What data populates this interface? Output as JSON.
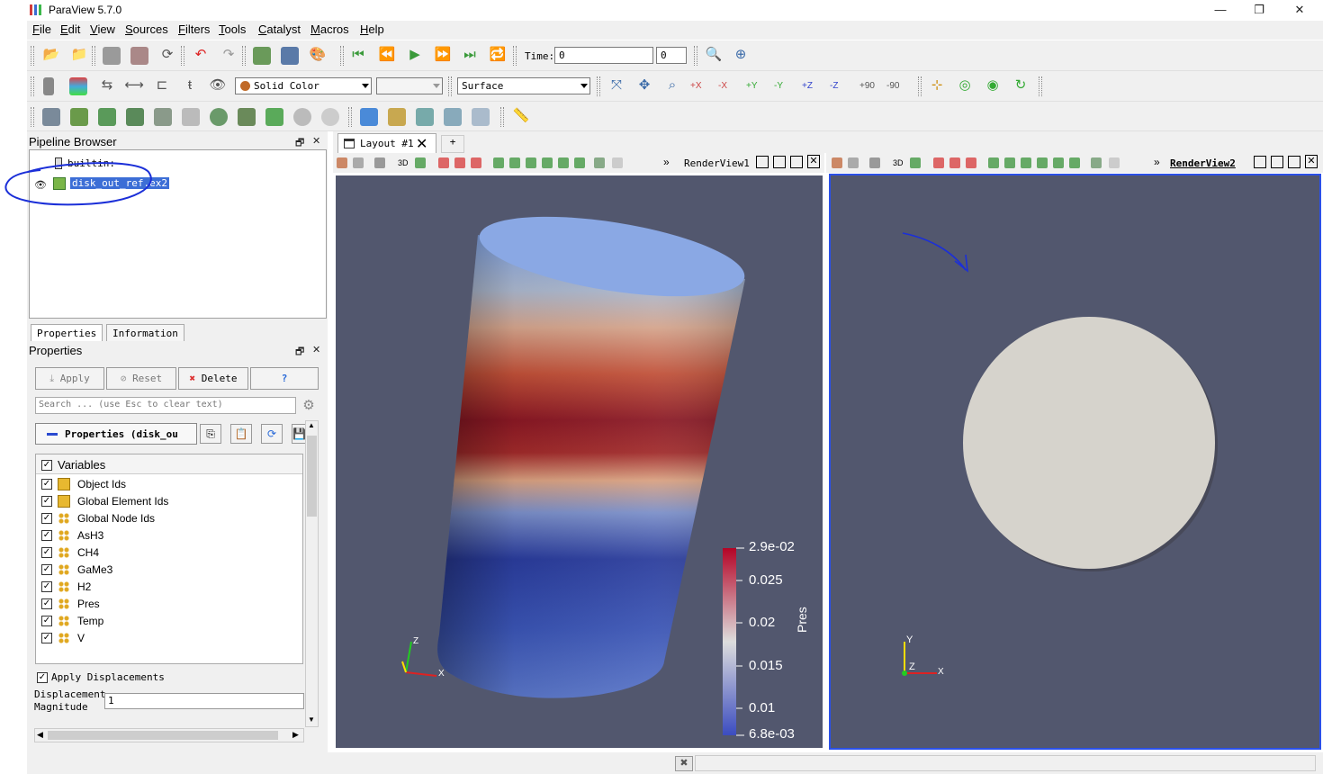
{
  "window": {
    "title": "ParaView 5.7.0",
    "minimize": "—",
    "maximize": "❐",
    "close": "✕"
  },
  "menu": [
    "File",
    "Edit",
    "View",
    "Sources",
    "Filters",
    "Tools",
    "Catalyst",
    "Macros",
    "Help"
  ],
  "toolbar": {
    "time_label": "Time:",
    "time_value": "0",
    "time_step": "0",
    "color_by": "Solid Color",
    "component": "",
    "representation": "Surface",
    "camera_buttons": [
      "+X",
      "-X",
      "+Y",
      "-Y",
      "+Z",
      "-Z",
      "+90",
      "-90"
    ]
  },
  "pipeline": {
    "title": "Pipeline Browser",
    "float": "🗗",
    "close": "✕",
    "items": [
      {
        "label": "builtin:"
      },
      {
        "label": "disk_out_ref.ex2",
        "selected": true
      }
    ]
  },
  "properties": {
    "tabs": [
      "Properties",
      "Information"
    ],
    "title": "Properties",
    "apply": "Apply",
    "reset": "Reset",
    "delete": "Delete",
    "help": "?",
    "search_placeholder": "Search ... (use Esc to clear text)",
    "section": "Properties (disk_ou",
    "variables_header": "Variables",
    "variables": [
      "Object Ids",
      "Global Element Ids",
      "Global Node Ids",
      "AsH3",
      "CH4",
      "GaMe3",
      "H2",
      "Pres",
      "Temp",
      "V"
    ],
    "apply_displacements": "Apply Displacements",
    "displacement_label_1": "Displacement",
    "displacement_label_2": "Magnitude",
    "displacement_value": "1"
  },
  "layout": {
    "tab": "Layout #1",
    "add": "+"
  },
  "views": {
    "view1_name": "RenderView1",
    "view2_name": "RenderView2",
    "threed": "3D",
    "more": "»"
  },
  "colorbar": {
    "title": "Pres",
    "labels": [
      "2.9e-02",
      "0.025",
      "0.02",
      "0.015",
      "0.01",
      "6.8e-03"
    ],
    "colors": {
      "high": "#b40426",
      "mid": "#dddddd",
      "low": "#3b4cc0"
    }
  },
  "axes": {
    "x": "X",
    "y": "Y",
    "z": "Z"
  },
  "colors": {
    "background": "#52576e",
    "active_view_border": "#2b50e8",
    "selection": "#3c6ed6",
    "annotation": "#1b2fd8"
  }
}
